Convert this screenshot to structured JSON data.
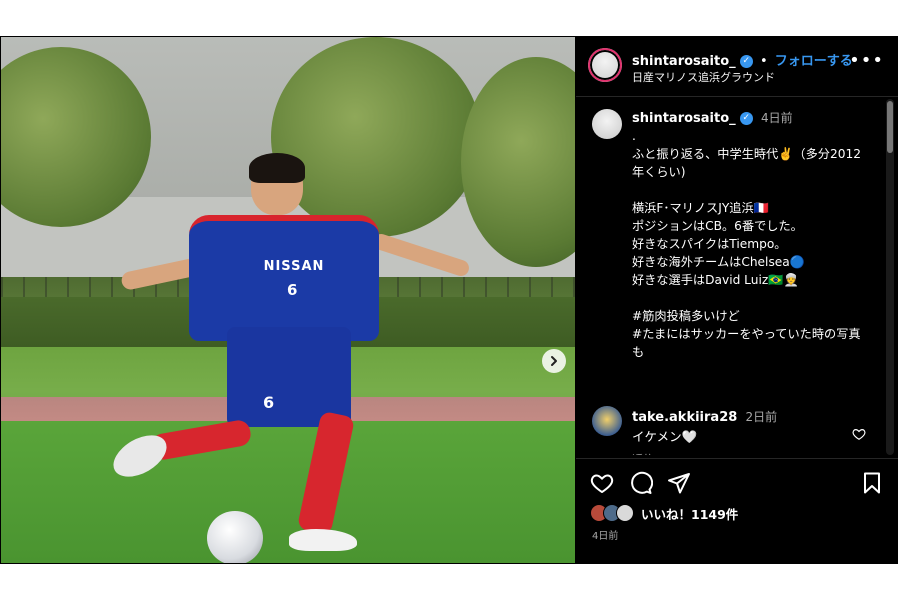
{
  "post": {
    "account": {
      "username": "shintarosaito_",
      "follow_label": "フォローする",
      "separator": "•",
      "location": "日産マリノス追浜グラウンド",
      "more_label": "•••"
    },
    "caption": {
      "username": "shintarosaito_",
      "time": "4日前",
      "text": ".\nふと振り返る、中学生時代✌️（多分2012年くらい)\n\n横浜F･マリノスJY追浜🇫🇷\nポジションはCB。6番でした。\n好きなスパイクはTiempo。\n好きな海外チームはChelsea🔵\n好きな選手はDavid Luiz🇧🇷👳\n\n#筋肉投稿多いけど\n#たまにはサッカーをやっていた時の写真も"
    },
    "comment": {
      "username": "take.akkiira28",
      "time": "2日前",
      "text": "イケメン🤍",
      "reply_label": "返信"
    },
    "photo": {
      "jersey_sponsor": "NISSAN",
      "jersey_number": "6",
      "shorts_number": "6"
    },
    "likes": {
      "text": "いいね！1149件"
    },
    "post_date": "4日前"
  },
  "icons": {
    "verified": "verified-badge-icon",
    "more": "more-options-icon",
    "next": "chevron-right-icon",
    "like": "heart-icon",
    "comment": "comment-icon",
    "share": "paper-plane-icon",
    "save": "bookmark-icon"
  },
  "colors": {
    "background": "#000000",
    "link_blue": "#3897f0",
    "secondary_text": "#a8a8a8",
    "divider": "#262626"
  }
}
